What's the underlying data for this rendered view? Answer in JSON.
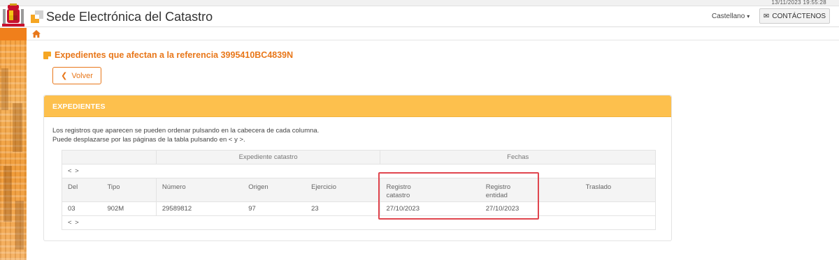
{
  "datetime": "13/11/2023  19:55:28",
  "header": {
    "site_title": "Sede Electrónica del Catastro",
    "language": "Castellano",
    "contact_label": "CONTÁCTENOS"
  },
  "page": {
    "title": "Expedientes que afectan a la referencia 3995410BC4839N",
    "back_label": "Volver"
  },
  "panel": {
    "header": "EXPEDIENTES",
    "info_line1": "Los registros que aparecen se pueden ordenar pulsando en la cabecera de cada columna.",
    "info_line2": "Puede desplazarse por las páginas de la tabla pulsando en < y >."
  },
  "table": {
    "group_headers": [
      "Expediente catastro",
      "Fechas"
    ],
    "nav": "< >",
    "columns": {
      "del": "Del",
      "tipo": "Tipo",
      "numero": "Número",
      "origen": "Origen",
      "ejercicio": "Ejercicio",
      "registro_catastro_1": "Registro",
      "registro_catastro_2": "catastro",
      "registro_entidad_1": "Registro",
      "registro_entidad_2": "entidad",
      "traslado": "Traslado"
    },
    "rows": [
      {
        "del": "03",
        "tipo": "902M",
        "numero": "29589812",
        "origen": "97",
        "ejercicio": "23",
        "registro_catastro": "27/10/2023",
        "registro_entidad": "27/10/2023",
        "traslado": ""
      }
    ]
  },
  "colors": {
    "accent": "#e8771a",
    "panel_header": "#fdc04d",
    "highlight": "#e0454e"
  }
}
